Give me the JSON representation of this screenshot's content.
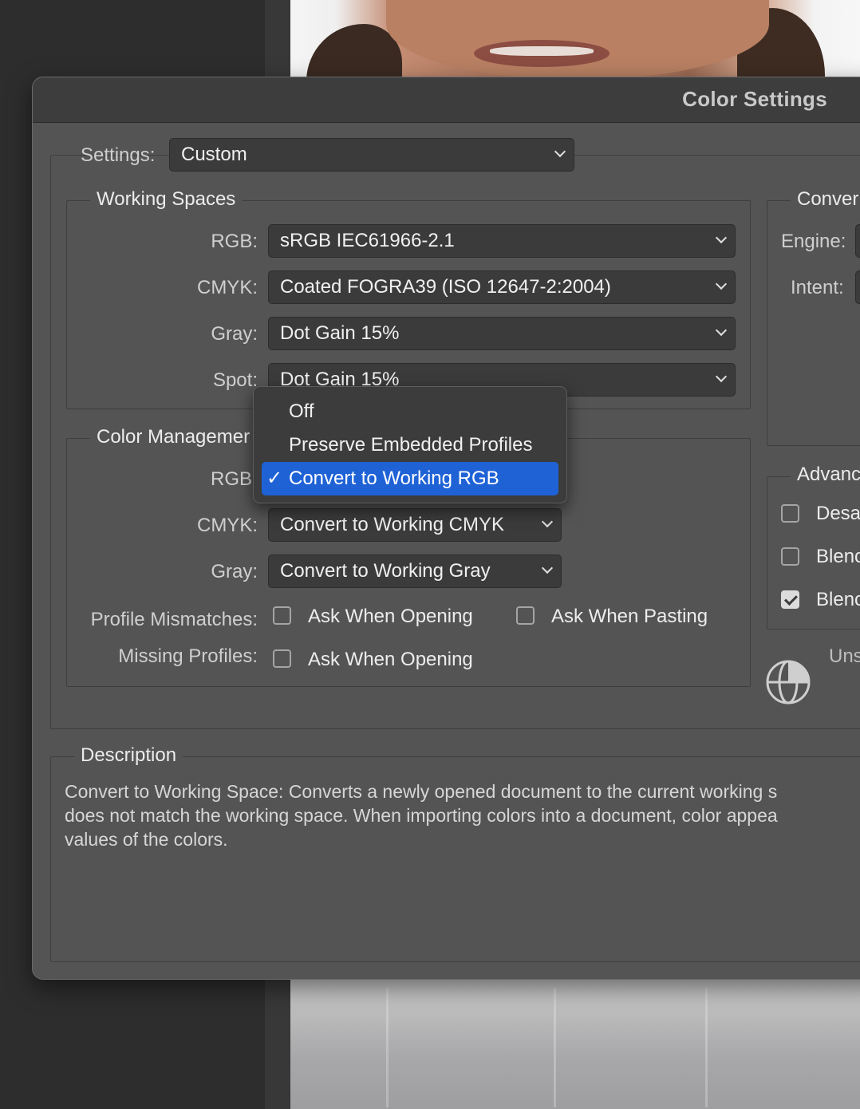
{
  "dialog": {
    "title": "Color Settings",
    "settings_label": "Settings:",
    "settings_value": "Custom"
  },
  "working_spaces": {
    "legend": "Working Spaces",
    "rgb_label": "RGB:",
    "rgb_value": "sRGB IEC61966-2.1",
    "cmyk_label": "CMYK:",
    "cmyk_value": "Coated FOGRA39 (ISO 12647-2:2004)",
    "gray_label": "Gray:",
    "gray_value": "Dot Gain 15%",
    "spot_label": "Spot:",
    "spot_value": "Dot Gain 15%"
  },
  "color_management": {
    "legend": "Color Managemer",
    "rgb_label": "RGB",
    "cmyk_label": "CMYK:",
    "cmyk_value": "Convert to Working CMYK",
    "gray_label": "Gray:",
    "gray_value": "Convert to Working Gray",
    "mismatch_label": "Profile Mismatches:",
    "mismatch_open": "Ask When Opening",
    "mismatch_paste": "Ask When Pasting",
    "missing_label": "Missing Profiles:",
    "missing_open": "Ask When Opening"
  },
  "rgb_menu": {
    "items": [
      "Off",
      "Preserve Embedded Profiles",
      "Convert to Working RGB"
    ],
    "selected": "Convert to Working RGB",
    "check": "✓"
  },
  "conversion": {
    "legend": "Conver",
    "engine_label": "Engine:",
    "intent_label": "Intent:"
  },
  "advanced": {
    "legend": "Advanc",
    "items": [
      {
        "label": "Desa",
        "checked": false
      },
      {
        "label": "Blenc",
        "checked": false
      },
      {
        "label": "Blenc",
        "checked": true
      }
    ]
  },
  "sync": {
    "status": "Uns",
    "icon": "sync-globe-icon"
  },
  "description": {
    "legend": "Description",
    "lines": [
      "Convert to Working Space:  Converts a newly opened document to the current working s",
      "does not match the working space.  When importing colors into a document, color appea",
      "values of the colors."
    ]
  },
  "colors": {
    "dialog_bg": "#545454",
    "menu_highlight": "#1f62d6"
  }
}
